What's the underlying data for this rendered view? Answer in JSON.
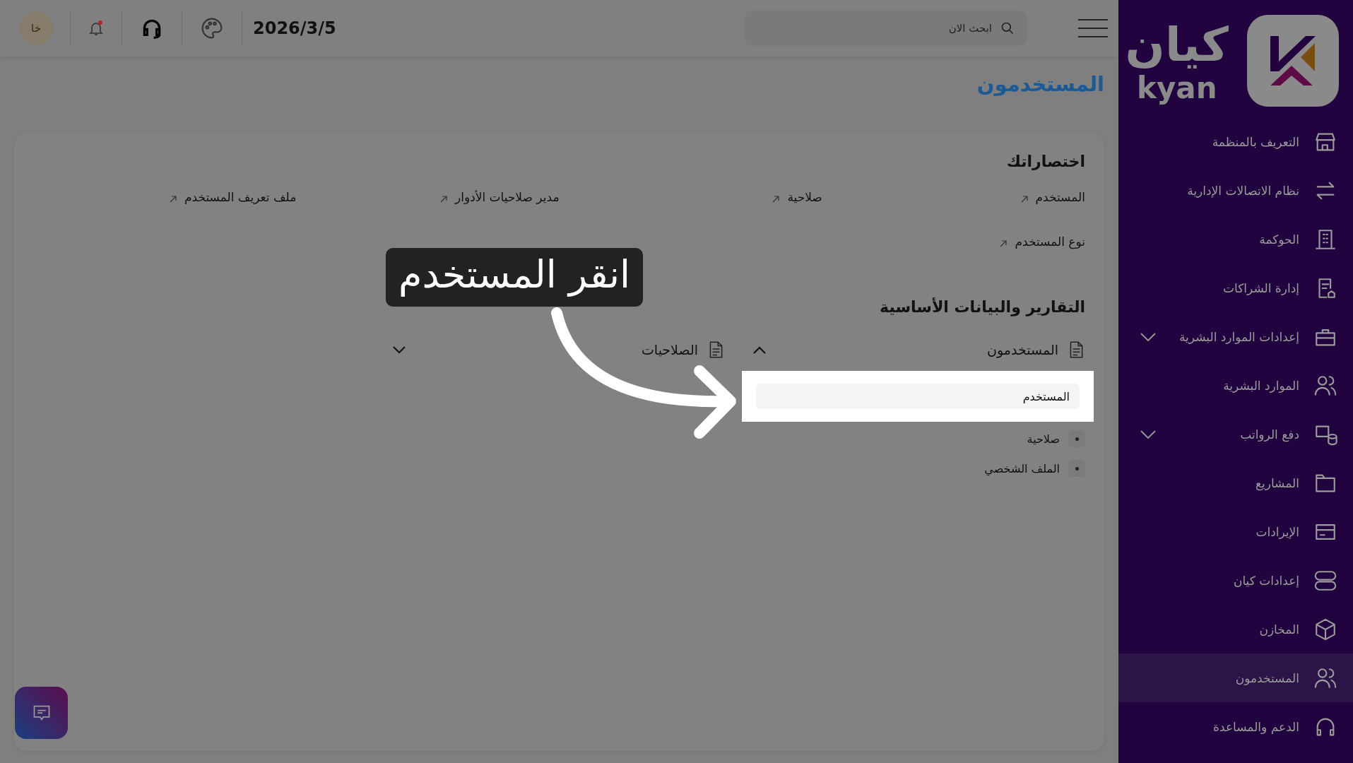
{
  "top_bar": {
    "search": {
      "placeholder": "ابحث الان"
    },
    "date": "2026/3/5",
    "notifications_unread": true,
    "avatar": "خا"
  },
  "sidebar": {
    "logo": {
      "arabic": "كيان",
      "latin": "kyan"
    },
    "items": [
      {
        "label": "التعريف بالمنظمة",
        "selected": false,
        "expandable": false
      },
      {
        "label": "نظام الاتصالات الإدارية",
        "selected": false,
        "expandable": false
      },
      {
        "label": "الحوكمة",
        "selected": false,
        "expandable": false
      },
      {
        "label": "إدارة الشراكات",
        "selected": false,
        "expandable": false
      },
      {
        "label": "إعدادات الموارد البشرية",
        "selected": false,
        "expandable": true
      },
      {
        "label": "الموارد البشرية",
        "selected": false,
        "expandable": false
      },
      {
        "label": "دفع الرواتب",
        "selected": false,
        "expandable": true
      },
      {
        "label": "المشاريع",
        "selected": false,
        "expandable": false
      },
      {
        "label": "الإيرادات",
        "selected": false,
        "expandable": false
      },
      {
        "label": "إعدادات كيان",
        "selected": false,
        "expandable": false
      },
      {
        "label": "المخازن",
        "selected": false,
        "expandable": false
      },
      {
        "label": "المستخدمون",
        "selected": true,
        "expandable": false
      },
      {
        "label": "الدعم والمساعدة",
        "selected": false,
        "expandable": false
      }
    ]
  },
  "page_title": "المستخدمون",
  "shortcuts": {
    "title": "اختصاراتك",
    "items": [
      "المستخدم",
      "صلاحية",
      "مدير صلاحيات الأدوار",
      "ملف تعريف المستخدم",
      "نوع المستخدم"
    ]
  },
  "reports": {
    "title": "التقارير والبيانات الأساسية",
    "groups": [
      {
        "label": "المستخدمون",
        "expanded": true,
        "items": [
          {
            "label": "المستخدم",
            "highlighted": true
          },
          {
            "label": "صلاحية",
            "highlighted": false
          },
          {
            "label": "الملف الشخصي",
            "highlighted": false
          }
        ]
      },
      {
        "label": "الصلاحيات",
        "expanded": false
      }
    ]
  },
  "callout": {
    "text": "انقر المستخدم"
  }
}
